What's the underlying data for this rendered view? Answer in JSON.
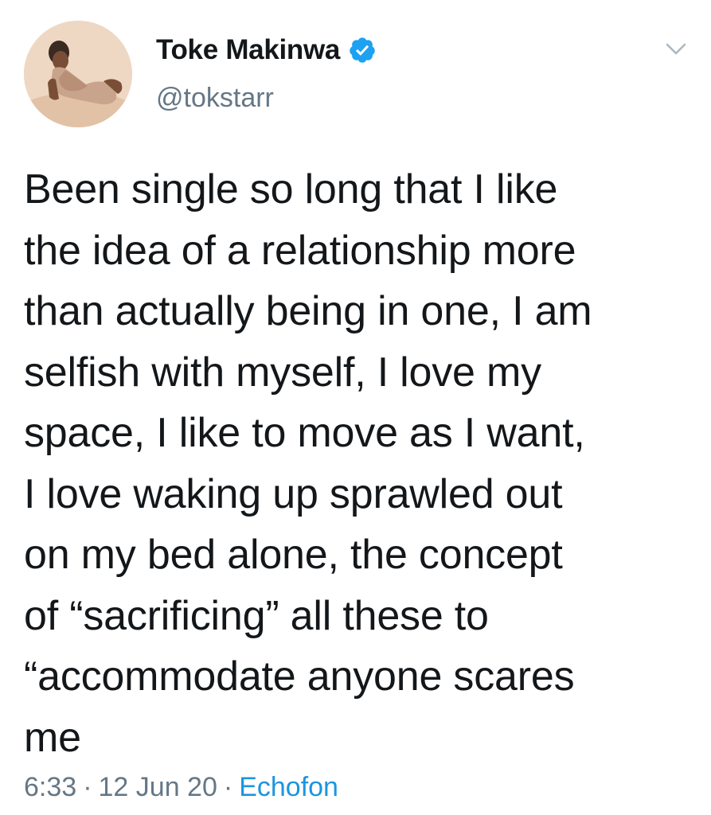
{
  "author": {
    "display_name": "Toke Makinwa",
    "handle": "@tokstarr",
    "verified": true,
    "avatar": "profile-photo"
  },
  "tweet": {
    "text_lines": [
      "Been single so long that I like",
      "the idea of a relationship more",
      "than actually being in one, I am",
      "selfish with myself, I love my",
      "space, I like to move as I want,",
      "I love waking up sprawled out",
      "on my bed alone, the concept",
      "of “sacrificing” all these to",
      "“accommodate anyone scares",
      "me"
    ]
  },
  "meta": {
    "time": "6:33",
    "separator": "·",
    "date": "12 Jun 20",
    "source": "Echofon"
  },
  "icons": {
    "verified": "verified-badge-icon",
    "menu": "chevron-down-icon"
  },
  "colors": {
    "text": "#14171a",
    "secondary": "#657786",
    "link": "#1b95e0",
    "verified": "#1da1f2"
  }
}
